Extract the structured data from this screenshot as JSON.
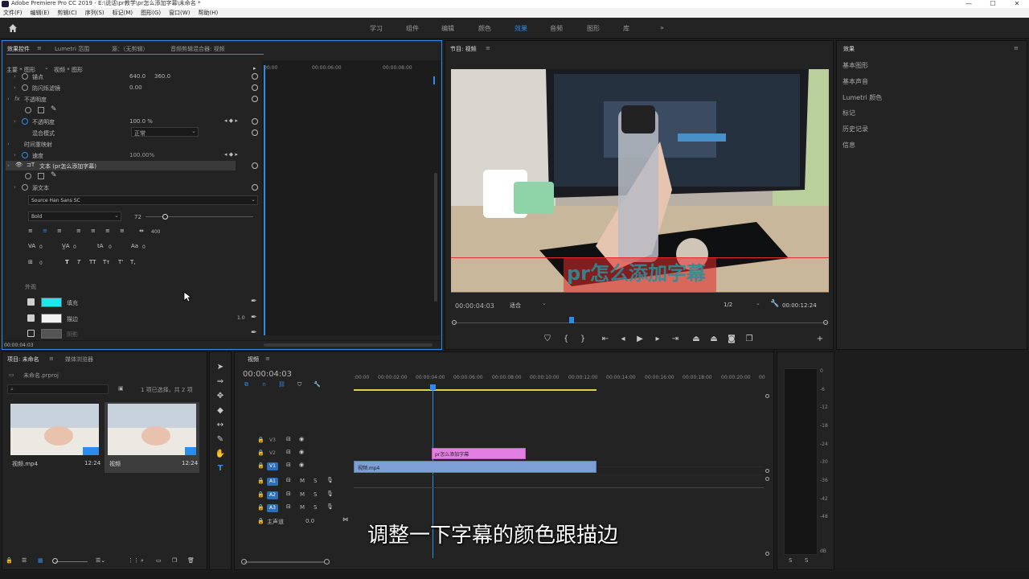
{
  "app": {
    "title": "Adobe Premiere Pro CC 2019 - E:\\说话\\pr教学\\pr怎么添加字幕\\未命名 *",
    "minimize": "—",
    "maximize": "☐",
    "close": "✕"
  },
  "menu": [
    "文件(F)",
    "编辑(E)",
    "剪辑(C)",
    "序列(S)",
    "标记(M)",
    "图形(G)",
    "窗口(W)",
    "帮助(H)"
  ],
  "workspaces": [
    "学习",
    "组件",
    "编辑",
    "颜色",
    "效果",
    "音频",
    "图形",
    "库"
  ],
  "workspace_active": "效果",
  "workspace_more": "»",
  "effect_controls": {
    "tabs": [
      "效果控件",
      "Lumetri 范围",
      "源：（无剪辑）",
      "音频剪辑混合器: 视频"
    ],
    "tab_menu": "≡",
    "source": "主要 * 图形",
    "clip": "视频 * 图形",
    "ruler": [
      "00:00",
      "00:00:06:00",
      "00:00:08:00"
    ],
    "anchor_label": "锚点",
    "anchor_x": "640.0",
    "anchor_y": "360.0",
    "flicker_label": "防闪烁滤镜",
    "flicker_val": "0.00",
    "opacity_group": "不透明度",
    "opacity_label": "不透明度",
    "opacity_val": "100.0 %",
    "blend_label": "混合模式",
    "blend_val": "正常",
    "timeremap_group": "时间重映射",
    "speed_label": "速度",
    "speed_val": "100.00%",
    "text_layer": "文本 (pr怎么添加字幕)",
    "source_text": "源文本",
    "font": "Source Han Sans SC",
    "weight": "Bold",
    "size": "72",
    "tracking_val": "400",
    "kern_val": "0",
    "vd_val": "0",
    "lead_val": "0",
    "baseline_val": "0",
    "tsume_val": "0",
    "styles": [
      "T",
      "T",
      "TT",
      "Tт",
      "T'",
      "T,"
    ],
    "appearance": "外观",
    "fill_label": "填充",
    "fill_color": "#1fe6ea",
    "stroke_label": "描边",
    "stroke_color": "#f2f2f2",
    "stroke_val": "1.0",
    "shadow_label": "阴影",
    "shadow_color": "#555555",
    "timecode": "00:00:04:03"
  },
  "program": {
    "title": "节目: 视频",
    "menu": "≡",
    "caption": "pr怎么添加字幕",
    "timecode": "00:00:04:03",
    "fit": "适合",
    "res": "1/2",
    "duration": "00:00:12:24"
  },
  "right_panel": {
    "title": "效果",
    "menu": "≡",
    "items": [
      "基本图形",
      "基本声音",
      "Lumetri 颜色",
      "标记",
      "历史记录",
      "信息"
    ]
  },
  "project": {
    "tabs": [
      "项目: 未命名",
      "媒体浏览器"
    ],
    "menu": "≡",
    "file": "未命名.prproj",
    "selection": "1 项已选择，共 2 项",
    "items": [
      {
        "name": "视频.mp4",
        "dur": "12:24"
      },
      {
        "name": "视频",
        "dur": "12:24"
      }
    ]
  },
  "timeline": {
    "title": "视频",
    "menu": "≡",
    "timecode": "00:00:04:03",
    "ruler": [
      ":00:00",
      "00:00:02:00",
      "00:00:04:00",
      "00:00:06:00",
      "00:00:08:00",
      "00:00:10:00",
      "00:00:12:00",
      "00:00:14:00",
      "00:00:16:00",
      "00:00:18:00",
      "00:00:20:00",
      "00"
    ],
    "tracks": [
      "V3",
      "V2",
      "V1",
      "A1",
      "A2",
      "A3"
    ],
    "master": "主声道",
    "master_val": "0.0",
    "text_clip": "pr怎么添加字幕",
    "video_clip": "视频.mp4",
    "m": "M",
    "s": "S"
  },
  "meter": {
    "labels": [
      "0",
      "-6",
      "-12",
      "-18",
      "-24",
      "-30",
      "-36",
      "-42",
      "-48",
      "dB"
    ],
    "s": "S"
  },
  "subtitle": "调整一下字幕的颜色跟描边"
}
